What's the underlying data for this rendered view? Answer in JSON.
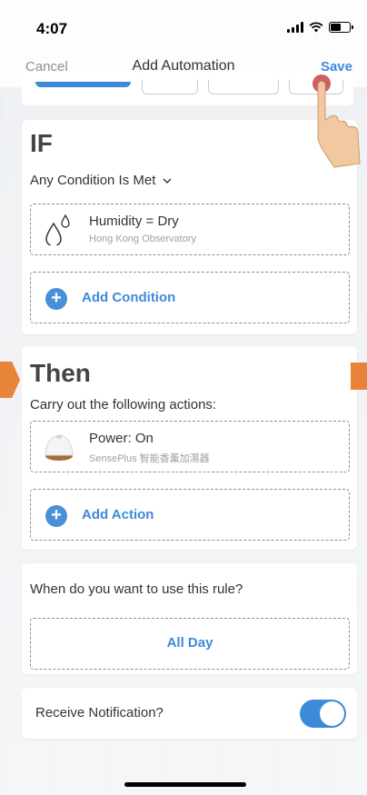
{
  "status_bar": {
    "time": "4:07"
  },
  "nav": {
    "cancel": "Cancel",
    "title": "Add Automation",
    "save": "Save"
  },
  "if_section": {
    "title": "IF",
    "mode": "Any Condition Is Met",
    "condition": {
      "label": "Humidity = Dry",
      "source": "Hong Kong Observatory",
      "icon": "droplets-icon"
    },
    "add_condition": "Add Condition"
  },
  "then_section": {
    "title": "Then",
    "subtitle": "Carry out the following actions:",
    "action": {
      "label": "Power: On",
      "device": "SensePlus 智能香薰加濕器",
      "icon": "humidifier-icon"
    },
    "add_action": "Add Action"
  },
  "rule_section": {
    "question": "When do you want to use this rule?",
    "value": "All Day"
  },
  "notification": {
    "label": "Receive Notification?",
    "enabled": true
  },
  "colors": {
    "accent": "#3d8ad8",
    "arrow": "#e8843a"
  }
}
